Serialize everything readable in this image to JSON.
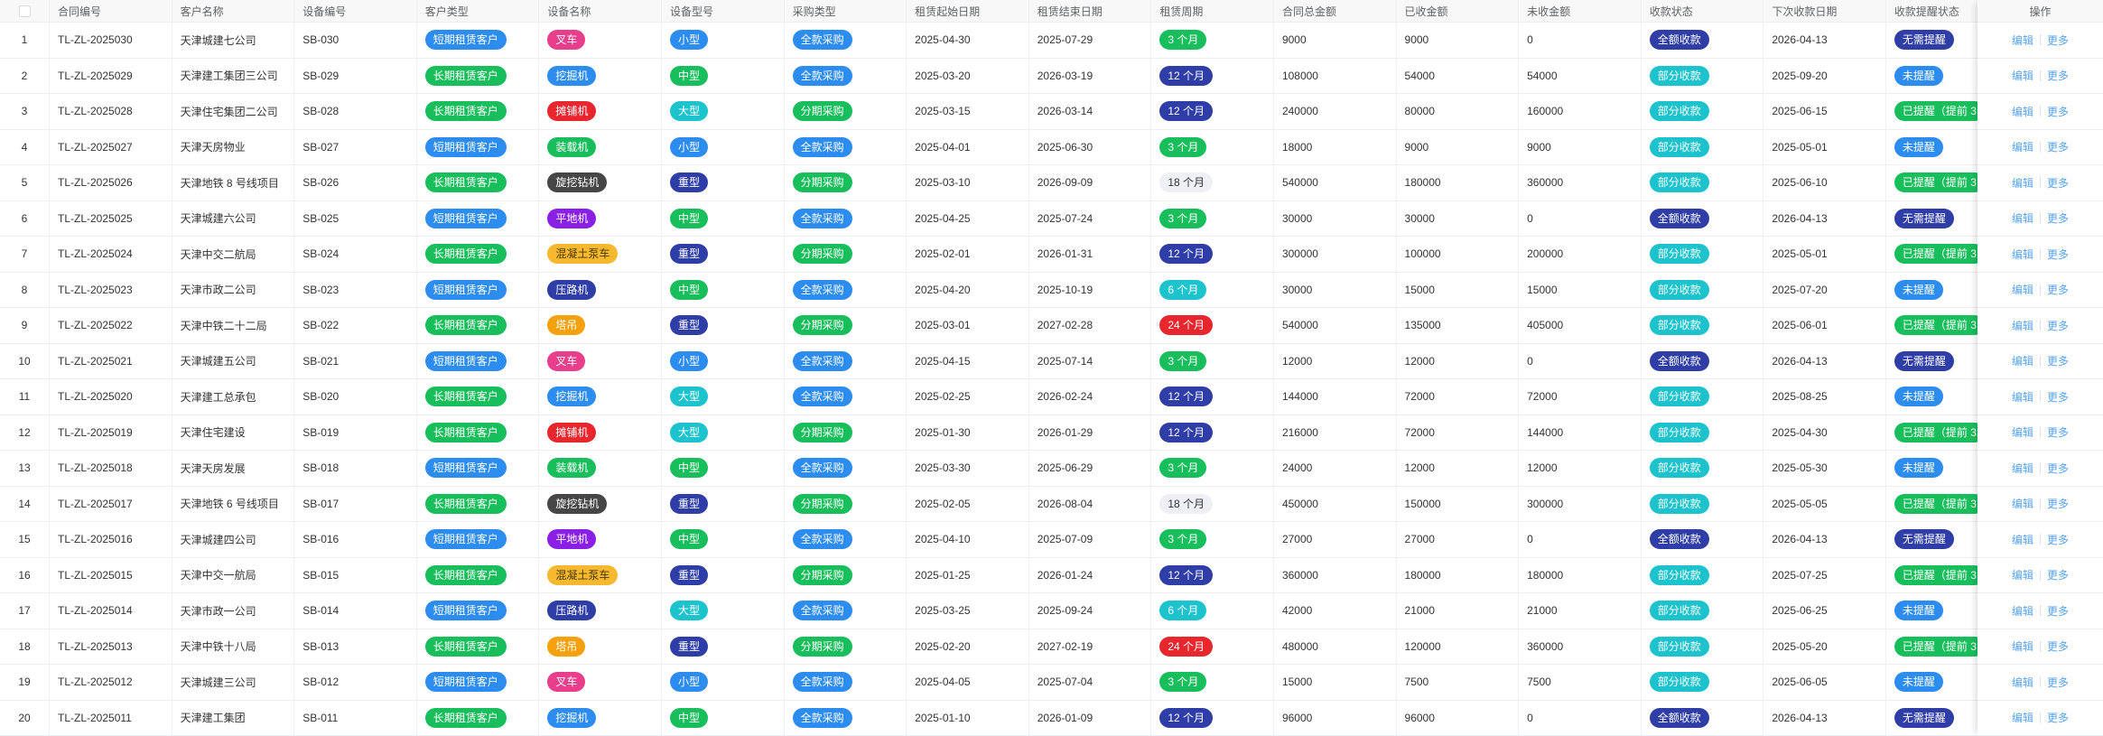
{
  "table": {
    "columns": [
      "合同编号",
      "客户名称",
      "设备编号",
      "客户类型",
      "设备名称",
      "设备型号",
      "采购类型",
      "租赁起始日期",
      "租赁结束日期",
      "租赁周期",
      "合同总金额",
      "已收金额",
      "未收金额",
      "收款状态",
      "下次收款日期",
      "收款提醒状态"
    ],
    "rows": [
      [
        "1",
        "TL-ZL-2025030",
        "天津城建七公司",
        "SB-030",
        "短期租赁客户",
        "叉车",
        "小型",
        "全款采购",
        "2025-04-30",
        "2025-07-29",
        "3 个月",
        "9000",
        "9000",
        "0",
        "全额收款",
        "2026-04-13",
        "无需提醒"
      ],
      [
        "2",
        "TL-ZL-2025029",
        "天津建工集团三公司",
        "SB-029",
        "长期租赁客户",
        "挖掘机",
        "中型",
        "全款采购",
        "2025-03-20",
        "2026-03-19",
        "12 个月",
        "108000",
        "54000",
        "54000",
        "部分收款",
        "2025-09-20",
        "未提醒"
      ],
      [
        "3",
        "TL-ZL-2025028",
        "天津住宅集团二公司",
        "SB-028",
        "长期租赁客户",
        "摊铺机",
        "大型",
        "分期采购",
        "2025-03-15",
        "2026-03-14",
        "12 个月",
        "240000",
        "80000",
        "160000",
        "部分收款",
        "2025-06-15",
        "已提醒（提前 3"
      ],
      [
        "4",
        "TL-ZL-2025027",
        "天津天房物业",
        "SB-027",
        "短期租赁客户",
        "装载机",
        "小型",
        "全款采购",
        "2025-04-01",
        "2025-06-30",
        "3 个月",
        "18000",
        "9000",
        "9000",
        "部分收款",
        "2025-05-01",
        "未提醒"
      ],
      [
        "5",
        "TL-ZL-2025026",
        "天津地铁 8 号线项目",
        "SB-026",
        "长期租赁客户",
        "旋挖钻机",
        "重型",
        "分期采购",
        "2025-03-10",
        "2026-09-09",
        "18 个月",
        "540000",
        "180000",
        "360000",
        "部分收款",
        "2025-06-10",
        "已提醒（提前 3"
      ],
      [
        "6",
        "TL-ZL-2025025",
        "天津城建六公司",
        "SB-025",
        "短期租赁客户",
        "平地机",
        "中型",
        "全款采购",
        "2025-04-25",
        "2025-07-24",
        "3 个月",
        "30000",
        "30000",
        "0",
        "全额收款",
        "2026-04-13",
        "无需提醒"
      ],
      [
        "7",
        "TL-ZL-2025024",
        "天津中交二航局",
        "SB-024",
        "长期租赁客户",
        "混凝土泵车",
        "重型",
        "分期采购",
        "2025-02-01",
        "2026-01-31",
        "12 个月",
        "300000",
        "100000",
        "200000",
        "部分收款",
        "2025-05-01",
        "已提醒（提前 3"
      ],
      [
        "8",
        "TL-ZL-2025023",
        "天津市政二公司",
        "SB-023",
        "短期租赁客户",
        "压路机",
        "中型",
        "全款采购",
        "2025-04-20",
        "2025-10-19",
        "6 个月",
        "30000",
        "15000",
        "15000",
        "部分收款",
        "2025-07-20",
        "未提醒"
      ],
      [
        "9",
        "TL-ZL-2025022",
        "天津中铁二十二局",
        "SB-022",
        "长期租赁客户",
        "塔吊",
        "重型",
        "分期采购",
        "2025-03-01",
        "2027-02-28",
        "24 个月",
        "540000",
        "135000",
        "405000",
        "部分收款",
        "2025-06-01",
        "已提醒（提前 3"
      ],
      [
        "10",
        "TL-ZL-2025021",
        "天津城建五公司",
        "SB-021",
        "短期租赁客户",
        "叉车",
        "小型",
        "全款采购",
        "2025-04-15",
        "2025-07-14",
        "3 个月",
        "12000",
        "12000",
        "0",
        "全额收款",
        "2026-04-13",
        "无需提醒"
      ],
      [
        "11",
        "TL-ZL-2025020",
        "天津建工总承包",
        "SB-020",
        "长期租赁客户",
        "挖掘机",
        "大型",
        "全款采购",
        "2025-02-25",
        "2026-02-24",
        "12 个月",
        "144000",
        "72000",
        "72000",
        "部分收款",
        "2025-08-25",
        "未提醒"
      ],
      [
        "12",
        "TL-ZL-2025019",
        "天津住宅建设",
        "SB-019",
        "长期租赁客户",
        "摊铺机",
        "大型",
        "分期采购",
        "2025-01-30",
        "2026-01-29",
        "12 个月",
        "216000",
        "72000",
        "144000",
        "部分收款",
        "2025-04-30",
        "已提醒（提前 3"
      ],
      [
        "13",
        "TL-ZL-2025018",
        "天津天房发展",
        "SB-018",
        "短期租赁客户",
        "装载机",
        "中型",
        "全款采购",
        "2025-03-30",
        "2025-06-29",
        "3 个月",
        "24000",
        "12000",
        "12000",
        "部分收款",
        "2025-05-30",
        "未提醒"
      ],
      [
        "14",
        "TL-ZL-2025017",
        "天津地铁 6 号线项目",
        "SB-017",
        "长期租赁客户",
        "旋挖钻机",
        "重型",
        "分期采购",
        "2025-02-05",
        "2026-08-04",
        "18 个月",
        "450000",
        "150000",
        "300000",
        "部分收款",
        "2025-05-05",
        "已提醒（提前 3"
      ],
      [
        "15",
        "TL-ZL-2025016",
        "天津城建四公司",
        "SB-016",
        "短期租赁客户",
        "平地机",
        "中型",
        "全款采购",
        "2025-04-10",
        "2025-07-09",
        "3 个月",
        "27000",
        "27000",
        "0",
        "全额收款",
        "2026-04-13",
        "无需提醒"
      ],
      [
        "16",
        "TL-ZL-2025015",
        "天津中交一航局",
        "SB-015",
        "长期租赁客户",
        "混凝土泵车",
        "重型",
        "分期采购",
        "2025-01-25",
        "2026-01-24",
        "12 个月",
        "360000",
        "180000",
        "180000",
        "部分收款",
        "2025-07-25",
        "已提醒（提前 3"
      ],
      [
        "17",
        "TL-ZL-2025014",
        "天津市政一公司",
        "SB-014",
        "短期租赁客户",
        "压路机",
        "大型",
        "全款采购",
        "2025-03-25",
        "2025-09-24",
        "6 个月",
        "42000",
        "21000",
        "21000",
        "部分收款",
        "2025-06-25",
        "未提醒"
      ],
      [
        "18",
        "TL-ZL-2025013",
        "天津中铁十八局",
        "SB-013",
        "长期租赁客户",
        "塔吊",
        "重型",
        "分期采购",
        "2025-02-20",
        "2027-02-19",
        "24 个月",
        "480000",
        "120000",
        "360000",
        "部分收款",
        "2025-05-20",
        "已提醒（提前 3"
      ],
      [
        "19",
        "TL-ZL-2025012",
        "天津城建三公司",
        "SB-012",
        "短期租赁客户",
        "叉车",
        "小型",
        "全款采购",
        "2025-04-05",
        "2025-07-04",
        "3 个月",
        "15000",
        "7500",
        "7500",
        "部分收款",
        "2025-06-05",
        "未提醒"
      ],
      [
        "20",
        "TL-ZL-2025011",
        "天津建工集团",
        "SB-011",
        "长期租赁客户",
        "挖掘机",
        "中型",
        "全款采购",
        "2025-01-10",
        "2026-01-09",
        "12 个月",
        "96000",
        "96000",
        "0",
        "全额收款",
        "2026-04-13",
        "无需提醒"
      ]
    ]
  },
  "actions": {
    "header": "操作",
    "edit": "编辑",
    "more": "更多"
  },
  "link_color": "#57a3f3",
  "tag_colors": {
    "短期租赁客户": {
      "bg": "#2d8cf0",
      "fg": "#ffffff"
    },
    "长期租赁客户": {
      "bg": "#19be5c",
      "fg": "#ffffff"
    },
    "叉车": {
      "bg": "#e83e8c",
      "fg": "#ffffff"
    },
    "挖掘机": {
      "bg": "#2d8cf0",
      "fg": "#ffffff"
    },
    "摊铺机": {
      "bg": "#e8262e",
      "fg": "#ffffff"
    },
    "装载机": {
      "bg": "#19be5c",
      "fg": "#ffffff"
    },
    "旋挖钻机": {
      "bg": "#464646",
      "fg": "#ffffff"
    },
    "平地机": {
      "bg": "#8a1fe6",
      "fg": "#ffffff"
    },
    "混凝土泵车": {
      "bg": "#f5b82e",
      "fg": "#4d3800"
    },
    "压路机": {
      "bg": "#2f3ea6",
      "fg": "#ffffff"
    },
    "塔吊": {
      "bg": "#f5a10c",
      "fg": "#ffffff"
    },
    "小型": {
      "bg": "#2d8cf0",
      "fg": "#ffffff"
    },
    "中型": {
      "bg": "#19be5c",
      "fg": "#ffffff"
    },
    "大型": {
      "bg": "#1cc3cd",
      "fg": "#ffffff"
    },
    "重型": {
      "bg": "#2f3ea6",
      "fg": "#ffffff"
    },
    "全款采购": {
      "bg": "#2d8cf0",
      "fg": "#ffffff"
    },
    "分期采购": {
      "bg": "#19be5c",
      "fg": "#ffffff"
    },
    "3 个月": {
      "bg": "#19be5c",
      "fg": "#ffffff"
    },
    "6 个月": {
      "bg": "#1cc3cd",
      "fg": "#ffffff"
    },
    "12 个月": {
      "bg": "#2f3ea6",
      "fg": "#ffffff"
    },
    "18 个月": {
      "bg": "#eef0f6",
      "fg": "#333333"
    },
    "24 个月": {
      "bg": "#e8262e",
      "fg": "#ffffff"
    },
    "全额收款": {
      "bg": "#2f3ea6",
      "fg": "#ffffff"
    },
    "部分收款": {
      "bg": "#1cc3cd",
      "fg": "#ffffff"
    },
    "无需提醒": {
      "bg": "#2f3ea6",
      "fg": "#ffffff"
    },
    "未提醒": {
      "bg": "#2d8cf0",
      "fg": "#ffffff"
    },
    "已提醒（提前 3": {
      "bg": "#19be5c",
      "fg": "#ffffff"
    }
  }
}
